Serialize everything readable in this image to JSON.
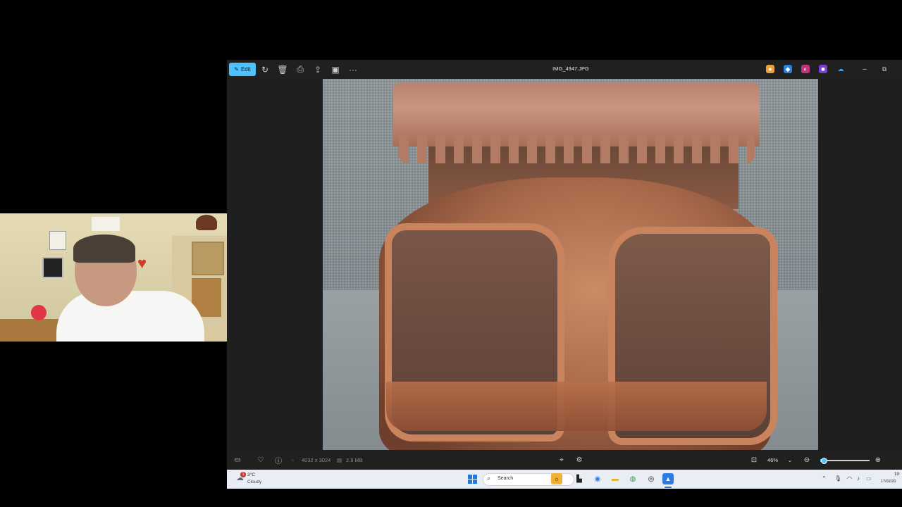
{
  "photos_app": {
    "toolbar": {
      "edit_label": "Edit",
      "more_label": "···"
    },
    "file_name": "IMG_4947.JPG",
    "window_controls": {
      "minimize": "–",
      "restore": "⧉"
    },
    "bottom_bar": {
      "dimensions": "4032 x 3024",
      "file_size": "2.9 MB",
      "zoom_level": "46%",
      "zoom_slider_fraction": 0.05
    }
  },
  "taskbar": {
    "weather": {
      "temperature": "3°C",
      "condition": "Cloudy",
      "badge": "1"
    },
    "search_placeholder": "Search",
    "clock": {
      "time": "19:",
      "date": "17/02/20"
    }
  },
  "colors": {
    "accent": "#4cc2ff",
    "window_bg": "#1f1f1f",
    "taskbar_bg": "#e9eef5"
  },
  "icons": {
    "toolbar": [
      "pencil-icon",
      "rotate-icon",
      "delete-icon",
      "print-icon",
      "share-icon",
      "slideshow-icon",
      "more-icon"
    ],
    "extensions": [
      "copilot-icon",
      "designer-icon",
      "clipchamp-icon",
      "planner-icon",
      "onedrive-icon"
    ],
    "bottom": [
      "filmstrip-icon",
      "favorite-icon",
      "info-icon",
      "visual-search-icon",
      "enhance-icon",
      "fit-screen-icon",
      "zoom-out-icon",
      "zoom-in-icon"
    ]
  }
}
